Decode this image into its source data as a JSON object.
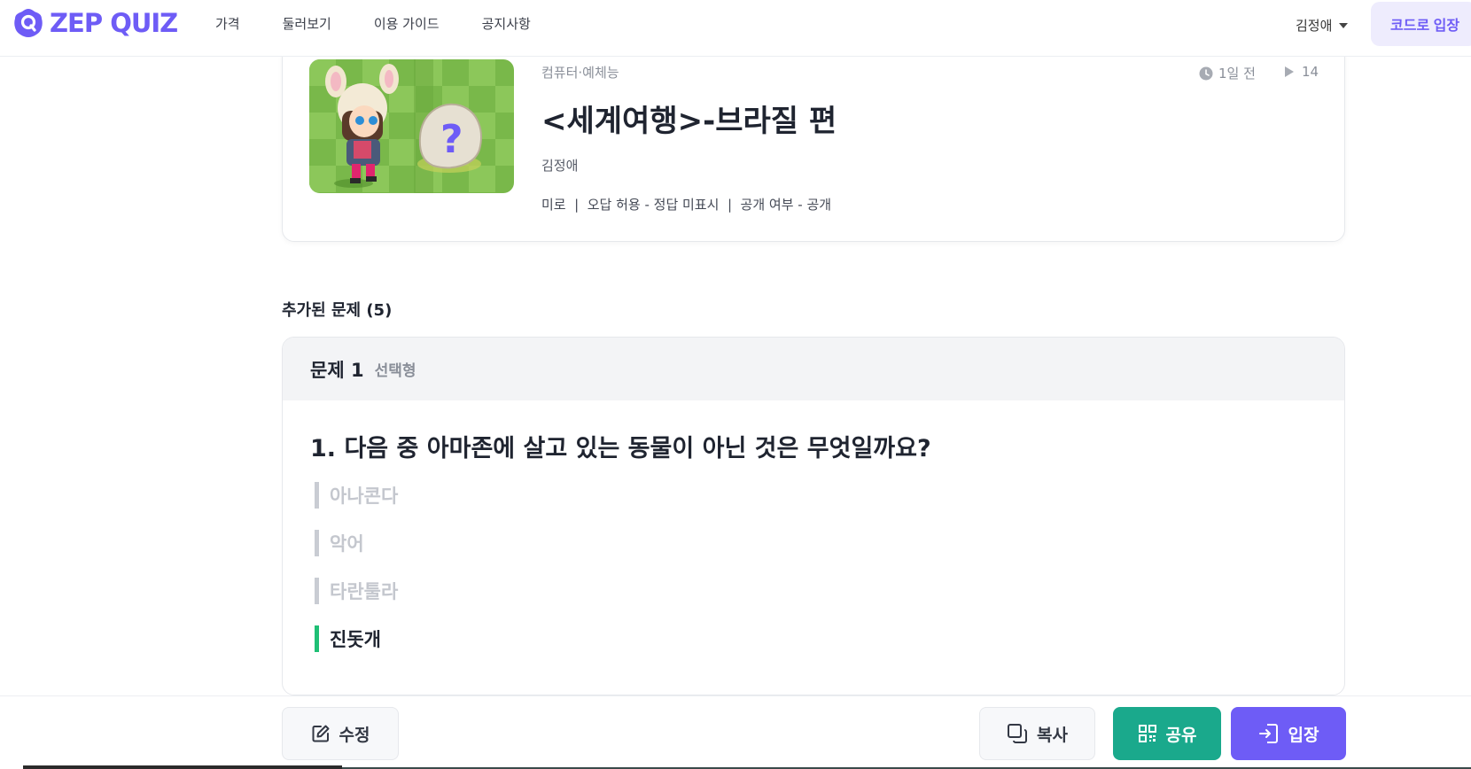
{
  "header": {
    "logo_text": "ZEP QUIZ",
    "nav": [
      "가격",
      "둘러보기",
      "이용 가이드",
      "공지사항"
    ],
    "user_name": "김정애",
    "code_entry_label": "코드로 입장"
  },
  "quiz": {
    "category": "컴퓨터·예체능",
    "time_ago": "1일 전",
    "play_count": "14",
    "title": "<세계여행>-브라질 편",
    "author": "김정애",
    "settings": "미로  |  오답 허용 - 정답 미표시  |  공개 여부 - 공개"
  },
  "section": {
    "added_questions_label": "추가된 문제 (5)"
  },
  "question": {
    "number_label": "문제 1",
    "type_label": "선택형",
    "text": "1. 다음 중 아마존에 살고 있는 동물이 아닌 것은 무엇일까요?",
    "options": [
      {
        "label": "아나콘다",
        "correct": false
      },
      {
        "label": "악어",
        "correct": false
      },
      {
        "label": "타란툴라",
        "correct": false
      },
      {
        "label": "진돗개",
        "correct": true
      }
    ]
  },
  "actions": {
    "edit_label": "수정",
    "copy_label": "복사",
    "share_label": "공유",
    "enter_label": "입장"
  },
  "colors": {
    "brand": "#6e5cf6",
    "share": "#1aa98c",
    "correct_marker": "#1fbf75"
  }
}
